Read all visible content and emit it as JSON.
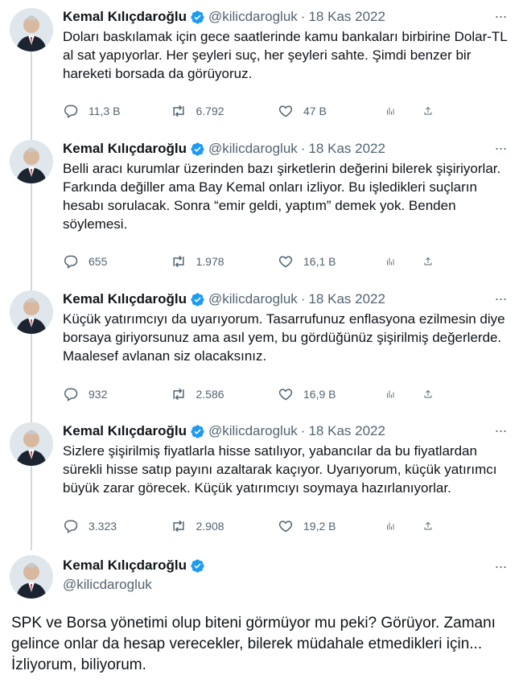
{
  "author": {
    "name": "Kemal Kılıçdaroğlu",
    "handle": "@kilicdarogluk",
    "date": "18 Kas 2022",
    "separator": "·",
    "more_label": "···"
  },
  "tweets": [
    {
      "text": "Doları baskılamak için gece saatlerinde kamu bankaları birbirine Dolar-TL al sat yapıyorlar. Her şeyleri suç, her şeyleri sahte. Şimdi benzer bir hareketi borsada da görüyoruz.",
      "replies": "11,3 B",
      "retweets": "6.792",
      "likes": "47 B"
    },
    {
      "text": "Belli aracı kurumlar üzerinden bazı şirketlerin değerini bilerek şişiriyorlar. Farkında değiller ama Bay Kemal onları izliyor. Bu işledikleri suçların hesabı sorulacak. Sonra “emir geldi, yaptım” demek yok. Benden söylemesi.",
      "replies": "655",
      "retweets": "1.978",
      "likes": "16,1 B"
    },
    {
      "text": "Küçük yatırımcıyı da uyarıyorum. Tasarrufunuz enflasyona ezilmesin diye borsaya giriyorsunuz ama asıl yem, bu gördüğünüz şişirilmiş değerlerde. Maalesef avlanan siz olacaksınız.",
      "replies": "932",
      "retweets": "2.586",
      "likes": "16,9 B"
    },
    {
      "text": "Sizlere şişirilmiş fiyatlarla hisse satılıyor, yabancılar da bu fiyatlardan sürekli hisse satıp payını azaltarak kaçıyor. Uyarıyorum, küçük yatırımcı büyük zarar görecek. Küçük yatırımcıyı soymaya hazırlanıyorlar.",
      "replies": "3.323",
      "retweets": "2.908",
      "likes": "19,2 B"
    }
  ],
  "final_tweet": {
    "text": "SPK ve Borsa yönetimi olup biteni görmüyor mu peki? Görüyor. Zamanı gelince onlar da hesap verecekler, bilerek müdahale etmedikleri için... İzliyorum, biliyorum."
  },
  "colors": {
    "text": "#0f1419",
    "secondary": "#536471",
    "verified": "#1d9bf0",
    "thread_line": "#cfd9de"
  },
  "icons": [
    "reply-icon",
    "retweet-icon",
    "like-icon",
    "views-icon",
    "share-icon",
    "verified-badge-icon",
    "more-icon"
  ]
}
